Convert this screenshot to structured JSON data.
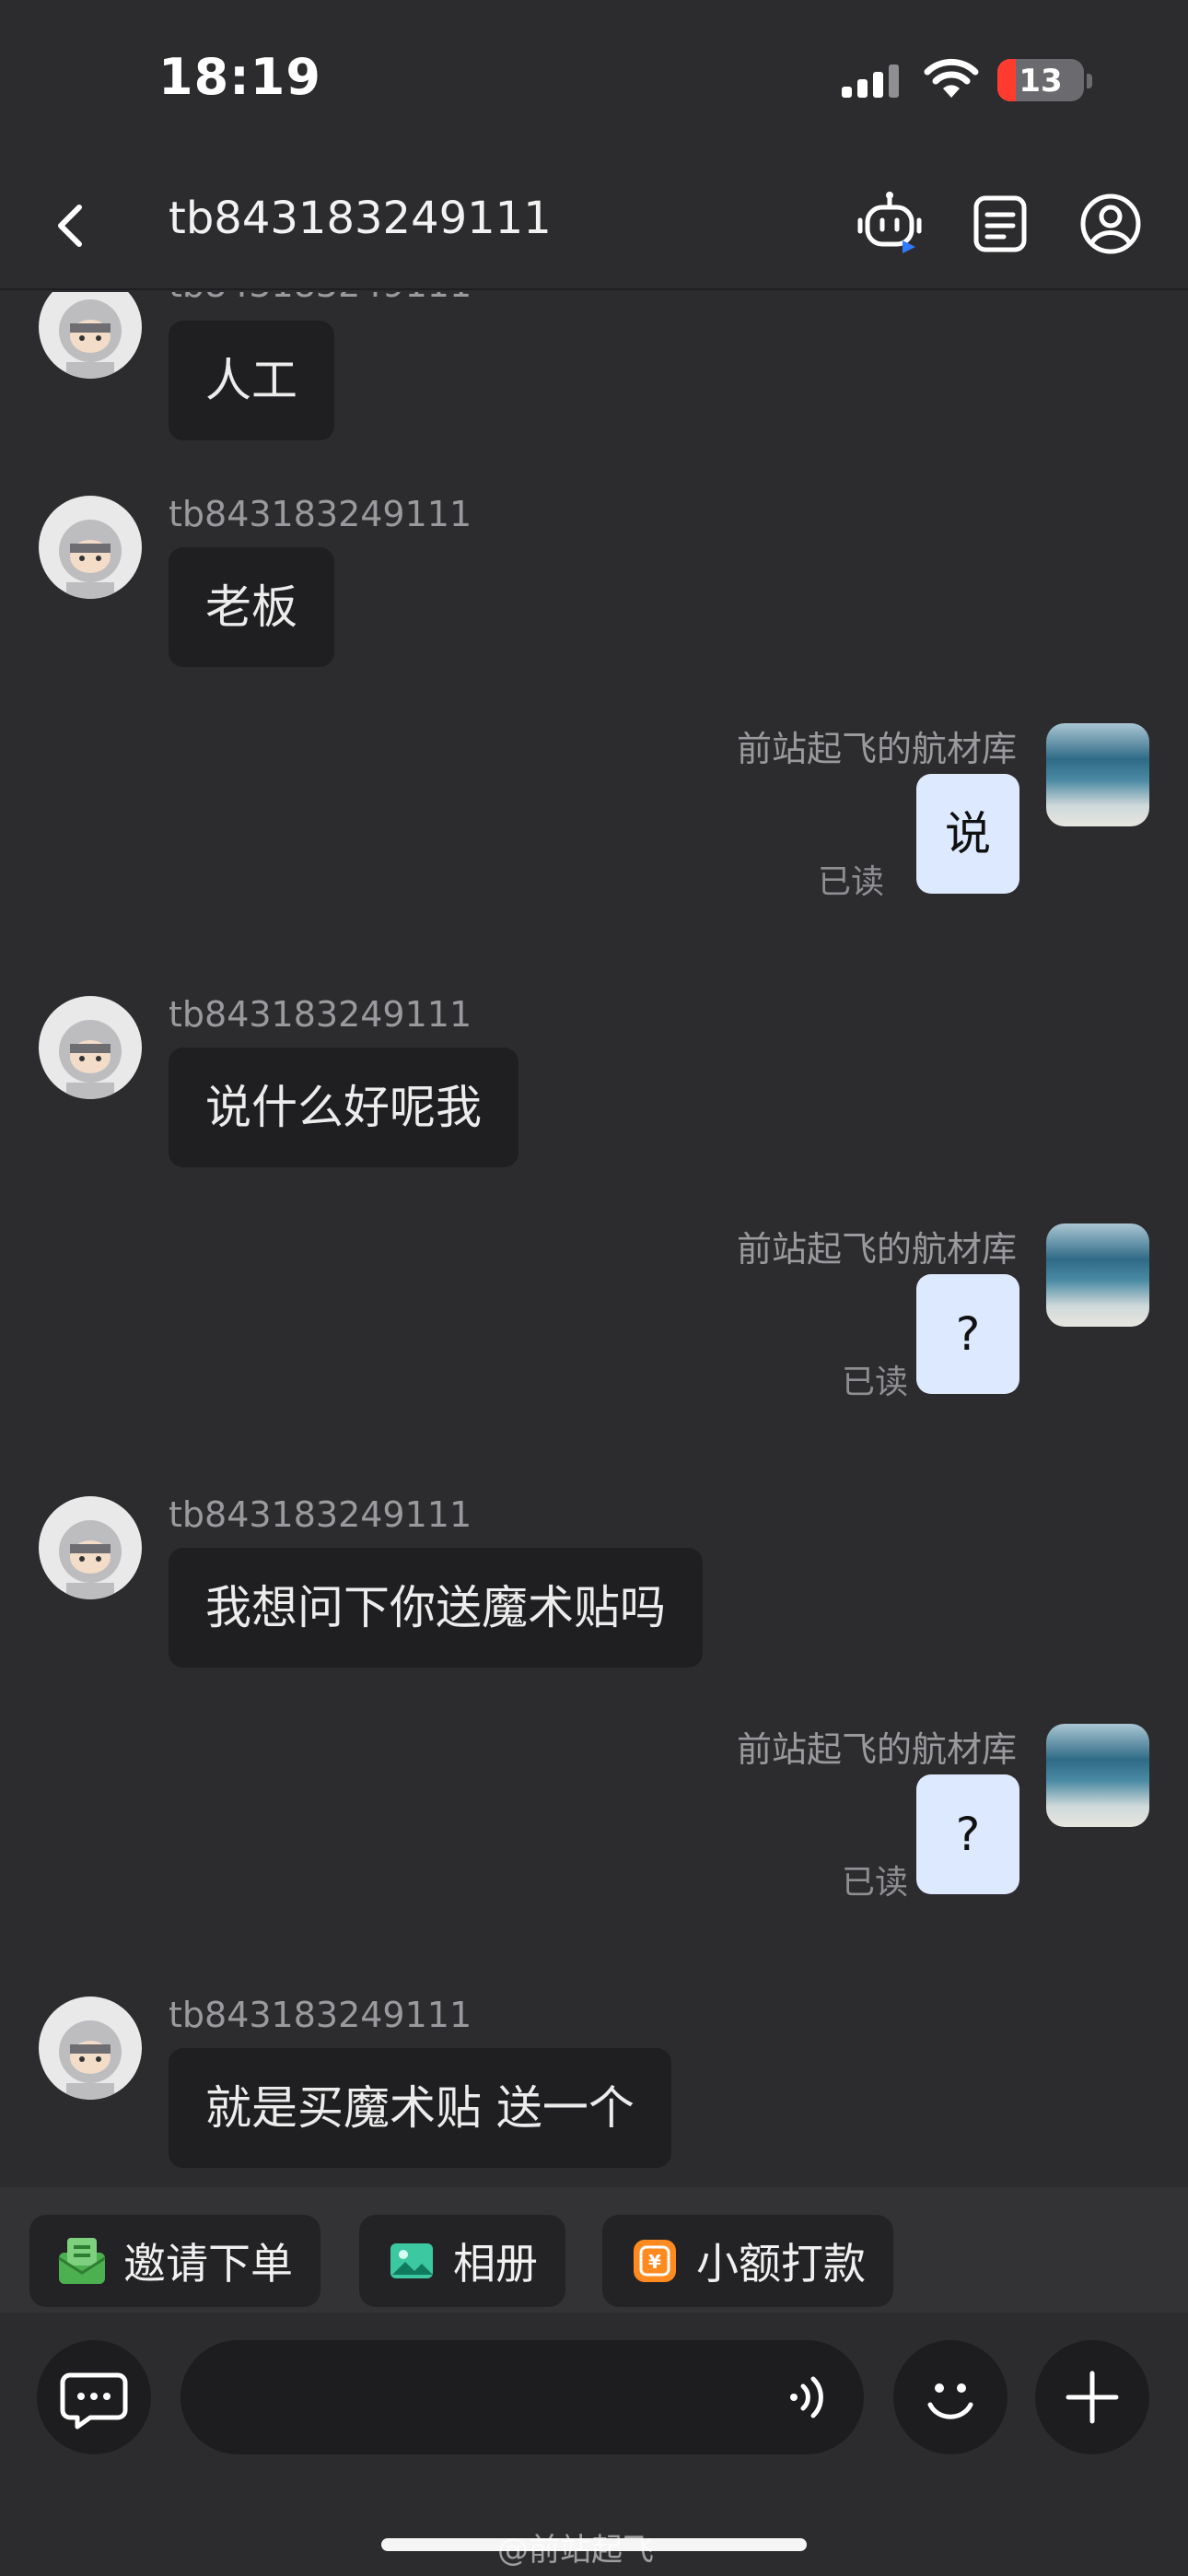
{
  "status_bar": {
    "time": "18:19",
    "battery": "13",
    "battery_level": 0.13
  },
  "header": {
    "title": "tb843183249111"
  },
  "messages": [
    {
      "sender": "tb843183249111",
      "text": "人工"
    },
    {
      "sender": "tb843183249111",
      "text": "老板"
    },
    {
      "sender": "前站起飞的航材库",
      "text": "说",
      "status": "已读"
    },
    {
      "sender": "tb843183249111",
      "text": "说什么好呢我"
    },
    {
      "sender": "前站起飞的航材库",
      "text": "?",
      "status": "已读"
    },
    {
      "sender": "tb843183249111",
      "text": "我想问下你送魔术贴吗"
    },
    {
      "sender": "前站起飞的航材库",
      "text": "?",
      "status": "已读"
    },
    {
      "sender": "tb843183249111",
      "text": "就是买魔术贴 送一个"
    }
  ],
  "quick_actions": [
    {
      "label": "邀请下单",
      "icon": "invite-order-icon",
      "color": "#4caf50"
    },
    {
      "label": "相册",
      "icon": "album-icon",
      "color": "#3cc8a0"
    },
    {
      "label": "小额打款",
      "icon": "small-payment-icon",
      "color": "#ff8a1f"
    }
  ],
  "input": {
    "placeholder": ""
  },
  "watermark": "@前站起飞",
  "colors": {
    "background": "#2c2c2e",
    "incoming_bubble": "#1f1f21",
    "outgoing_bubble": "#dde9ff",
    "battery_low": "#ff3b30"
  }
}
